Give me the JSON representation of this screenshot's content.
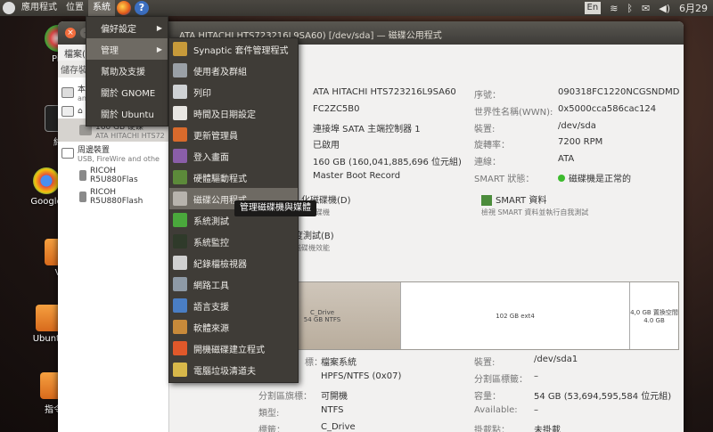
{
  "panel": {
    "applications": "應用程式",
    "places": "位置",
    "system": "系統",
    "help_icon": "?",
    "lang": "En",
    "date": "6月29"
  },
  "desktop_icons": [
    {
      "label": "Pic"
    },
    {
      "label": "終"
    },
    {
      "label": "Google"
    },
    {
      "label": "V"
    },
    {
      "label": "Ubuntu"
    },
    {
      "label": "指令"
    }
  ],
  "window": {
    "title": "ATA HITACHI HTS723216L9SA60) [/dev/sda] — 磁碟公用程式",
    "menubar": [
      "檔案(F",
      "說明"
    ],
    "sidebar": {
      "header": "儲存裝",
      "rows": [
        {
          "name": "本",
          "sub": "an"
        },
        {
          "name": "⌂",
          "sub": ""
        },
        {
          "name": "160 GB 硬碟",
          "sub": "ATA HITACHI HTS72"
        },
        {
          "name": "周邊裝置",
          "sub": "USB, FireWire and othe"
        },
        {
          "name": "RICOH R5U880Flas",
          "sub": ""
        },
        {
          "name": "RICOH R5U880Flash",
          "sub": ""
        }
      ]
    },
    "drive": {
      "model": "ATA HITACHI HTS723216L9SA60",
      "firmware": "FC2ZC5B0",
      "connection": "連接埠 SATA 主端控制器 1",
      "status": "已啟用",
      "capacity": "160 GB (160,041,885,696 位元組)",
      "partitioning": "Master Boot Record",
      "serial_label": "序號：",
      "serial": "090318FC1220NCGSNDMD",
      "wwn_label": "世界性名稱(WWN):",
      "wwn": "0x5000cca586cac124",
      "device_label": "裝置:",
      "device": "/dev/sda",
      "rpm_label": "旋轉率：",
      "rpm": "7200 RPM",
      "conn_label": "連線：",
      "conn": "ATA",
      "smart_label": "SMART 狀態：",
      "smart": "磁碟機是正常的"
    },
    "actions": [
      {
        "label": "化磁碟機(D)",
        "desc": "除磁碟機"
      },
      {
        "label": "SMART 資料",
        "desc": "檢視 SMART 資料並執行自我測試"
      },
      {
        "label": "度測試(B)",
        "desc": "磁碟機效能"
      }
    ],
    "volumes": [
      {
        "name": "C_Drive",
        "size": "54 GB NTFS"
      },
      {
        "name": "",
        "size": "102 GB ext4"
      },
      {
        "name": "4,0 GB 置換空間",
        "size": "4.0 GB"
      }
    ],
    "partition": {
      "fs_label": "檔案系統",
      "scheme": "HPFS/NTFS (0x07)",
      "flags_label": "分割區旗標：",
      "flags": "可開機",
      "type_label": "類型:",
      "type": "NTFS",
      "tag_label": "標籤：",
      "tag": "C_Drive",
      "dev_label": "裝置:",
      "dev": "/dev/sda1",
      "plabel_label": "分割區標籤：",
      "plabel": "–",
      "cap_label": "容量：",
      "cap": "54 GB (53,694,595,584 位元組)",
      "avail_label": "Available:",
      "avail": "–",
      "mount_label": "掛載點：",
      "mount": "未掛載",
      "sch_label": "標："
    }
  },
  "system_menu": [
    {
      "label": "偏好設定"
    },
    {
      "label": "管理"
    },
    {
      "label": "幫助及支援"
    },
    {
      "label": "關於 GNOME"
    },
    {
      "label": "關於 Ubuntu"
    }
  ],
  "admin_menu": [
    {
      "label": "Synaptic 套件管理程式",
      "color": "#c79a3a"
    },
    {
      "label": "使用者及群組",
      "color": "#9aa0a6"
    },
    {
      "label": "列印",
      "color": "#cfd2d4"
    },
    {
      "label": "時間及日期設定",
      "color": "#e8e6e2"
    },
    {
      "label": "更新管理員",
      "color": "#d86a2c"
    },
    {
      "label": "登入畫面",
      "color": "#8a5ea8"
    },
    {
      "label": "硬體驅動程式",
      "color": "#5c8a3a"
    },
    {
      "label": "磁碟公用程式",
      "color": "#b7b3ad"
    },
    {
      "label": "系統測試",
      "color": "#4aa83c"
    },
    {
      "label": "系統監控",
      "color": "#2f3a2a"
    },
    {
      "label": "紀錄檔檢視器",
      "color": "#d0d0d0"
    },
    {
      "label": "網路工具",
      "color": "#8e9aa6"
    },
    {
      "label": "語言支援",
      "color": "#4a7ec4"
    },
    {
      "label": "軟體來源",
      "color": "#c88a3a"
    },
    {
      "label": "開機磁碟建立程式",
      "color": "#e0582a"
    },
    {
      "label": "電腦垃圾清道夫",
      "color": "#d8b84a"
    }
  ],
  "tooltip": "管理磁碟機與媒體"
}
